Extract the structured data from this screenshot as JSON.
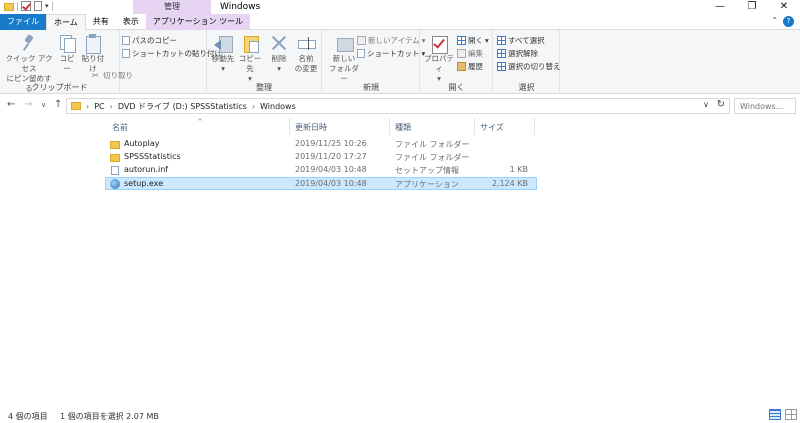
{
  "titlebar": {
    "title": "Windows",
    "manage_tab": "管理",
    "minimize": "—",
    "maximize": "❐",
    "close": "✕"
  },
  "tabs": [
    {
      "label": "ファイル"
    },
    {
      "label": "ホーム"
    },
    {
      "label": "共有"
    },
    {
      "label": "表示"
    },
    {
      "label": "アプリケーション ツール"
    }
  ],
  "ribbon": {
    "clipboard": {
      "label": "クリップボード",
      "pin_label_1": "クイック アクセス",
      "pin_label_2": "にピン留めする",
      "copy": "コピー",
      "paste_1": "貼り付け",
      "copy_path": "パスのコピー",
      "paste_shortcut": "ショートカットの貼り付け",
      "cut": "切り取り"
    },
    "organize": {
      "label": "整理",
      "move_to": "移動先",
      "copy_to": "コピー先",
      "delete": "削除",
      "rename_1": "名前",
      "rename_2": "の変更"
    },
    "new": {
      "label": "新規",
      "new_folder_1": "新しい",
      "new_folder_2": "フォルダー",
      "new_item": "新しいアイテム",
      "shortcut": "ショートカット"
    },
    "open": {
      "label": "開く",
      "properties": "プロパティ",
      "open": "開く",
      "edit": "編集",
      "history": "履歴"
    },
    "select": {
      "label": "選択",
      "select_all": "すべて選択",
      "select_none": "選択解除",
      "invert": "選択の切り替え"
    }
  },
  "address": {
    "segments": [
      "PC",
      "DVD ドライブ (D:) SPSSStatistics",
      "Windows"
    ],
    "search_placeholder": "Windows..."
  },
  "filelist": {
    "columns": {
      "name": "名前",
      "date": "更新日時",
      "type": "種類",
      "size": "サイズ"
    },
    "rows": [
      {
        "name": "Autoplay",
        "date": "2019/11/25 10:26",
        "type": "ファイル フォルダー",
        "size": ""
      },
      {
        "name": "SPSSStatistics",
        "date": "2019/11/20 17:27",
        "type": "ファイル フォルダー",
        "size": ""
      },
      {
        "name": "autorun.inf",
        "date": "2019/04/03 10:48",
        "type": "セットアップ情報",
        "size": "1 KB"
      },
      {
        "name": "setup.exe",
        "date": "2019/04/03 10:48",
        "type": "アプリケーション",
        "size": "2,124 KB"
      }
    ]
  },
  "status": {
    "item_count": "4 個の項目",
    "selection": "1 個の項目を選択  2.07 MB"
  }
}
